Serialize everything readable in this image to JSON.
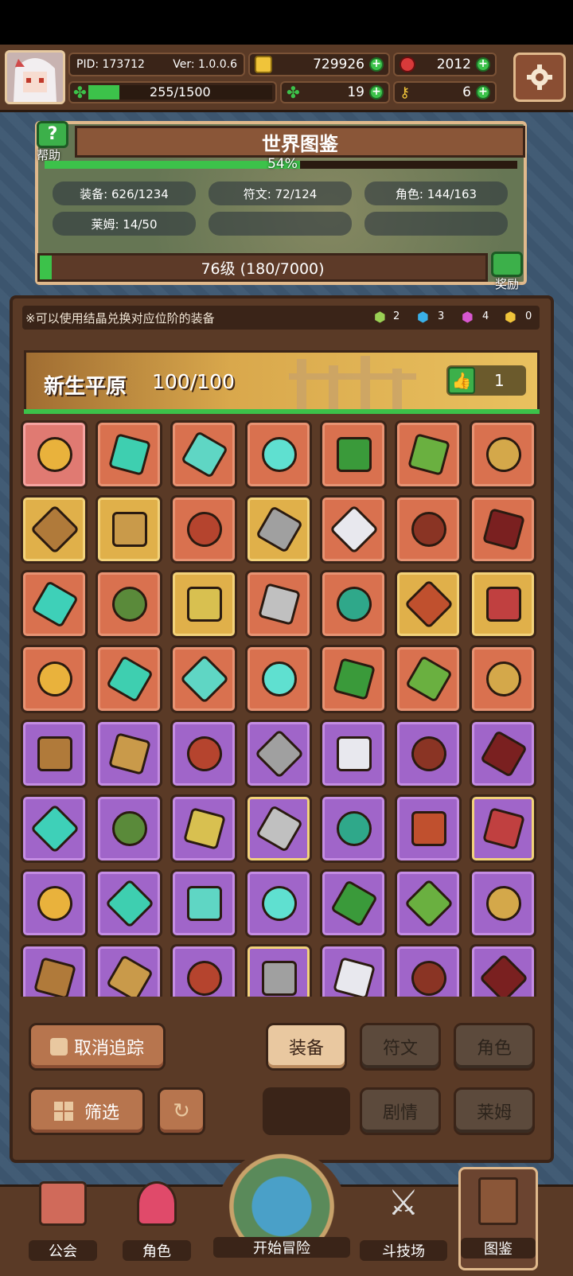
{
  "header": {
    "pid": "PID: 173712",
    "version": "Ver: 1.0.0.6",
    "gold": "729926",
    "gems": "2012",
    "exp": "255/1500",
    "exp_fraction": 0.17,
    "clover": "19",
    "key": "6"
  },
  "world": {
    "title": "世界图鉴",
    "help_label": "帮助",
    "percent": "54%",
    "percent_value": 0.54,
    "stats": [
      "装备: 626/1234",
      "符文: 72/124",
      "角色: 144/163",
      "莱姆: 14/50"
    ],
    "level_text": "76级 (180/7000)",
    "level_fraction": 0.026,
    "reward_label": "奖励"
  },
  "notice": "※可以使用结晶兑换对应位阶的装备",
  "crystals": [
    "2",
    "3",
    "4",
    "0"
  ],
  "region": {
    "name": "新生平原",
    "progress": "100/100",
    "likes": "1"
  },
  "buttons": {
    "untrack": "取消追踪",
    "filter": "筛选",
    "tab_equip": "装备",
    "tab_rune": "符文",
    "tab_role": "角色",
    "tab_story": "剧情",
    "tab_lime": "莱姆"
  },
  "nav": {
    "guild": "公会",
    "role": "角色",
    "adventure": "开始冒险",
    "arena": "斗技场",
    "codex": "图鉴"
  },
  "colors": {
    "accent_green": "#3cc24a",
    "panel_brown": "#5a3a26",
    "rarity_orange": "#d9714f",
    "rarity_gold": "#e0b04a",
    "rarity_purple": "#a065c9"
  }
}
